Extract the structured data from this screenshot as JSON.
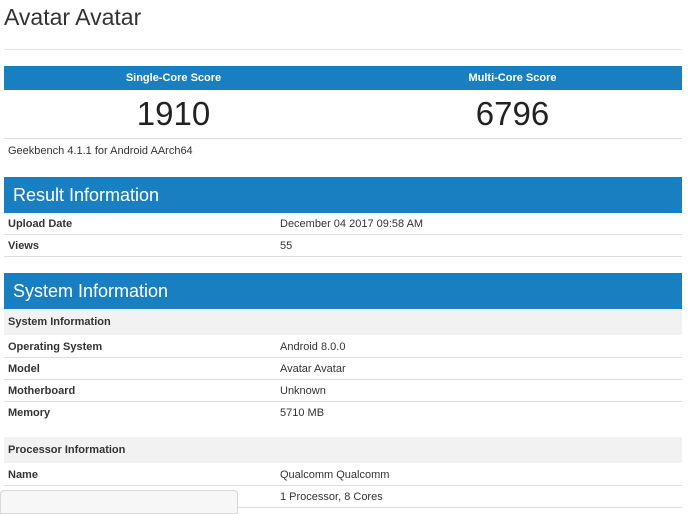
{
  "page": {
    "title": "Avatar Avatar"
  },
  "scores": {
    "single_label": "Single-Core Score",
    "multi_label": "Multi-Core Score",
    "single_value": "1910",
    "multi_value": "6796"
  },
  "benchmark_version": "Geekbench 4.1.1 for Android AArch64",
  "result_info": {
    "title": "Result Information",
    "rows": [
      {
        "label": "Upload Date",
        "value": "December 04 2017 09:58 AM"
      },
      {
        "label": "Views",
        "value": "55"
      }
    ]
  },
  "system_info": {
    "title": "System Information",
    "subheading": "System Information",
    "rows": [
      {
        "label": "Operating System",
        "value": "Android 8.0.0"
      },
      {
        "label": "Model",
        "value": "Avatar Avatar"
      },
      {
        "label": "Motherboard",
        "value": "Unknown"
      },
      {
        "label": "Memory",
        "value": "5710 MB"
      }
    ],
    "processor_subheading": "Processor Information",
    "processor_rows": [
      {
        "label": "Name",
        "value": "Qualcomm Qualcomm"
      },
      {
        "label": "",
        "value": "1 Processor, 8 Cores"
      }
    ]
  }
}
